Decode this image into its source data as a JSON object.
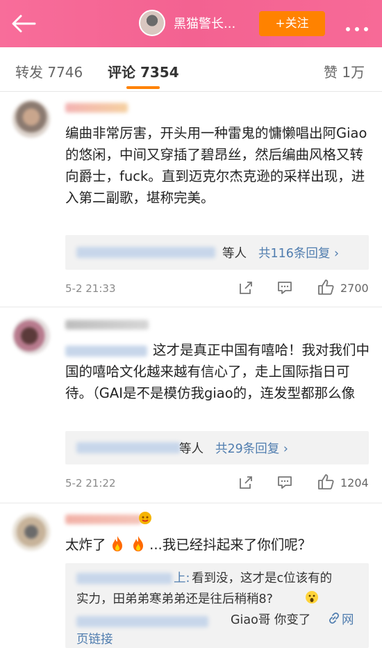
{
  "header": {
    "back_icon": "back-arrow-icon",
    "user_name": "黑猫警长...",
    "follow_label": "+关注",
    "more_icon": "more-dots-icon"
  },
  "tabs": {
    "repost": "转发 7746",
    "comments": "评论 7354",
    "likes": "赞 1万"
  },
  "comments": [
    {
      "text": "编曲非常厉害，开头用一种雷鬼的慵懒唱出阿Giao的悠闲，中间又穿插了碧昂丝，然后编曲风格又转向爵士，fuck。直到迈克尔杰克逊的采样出现，进入第二副歌，堪称完美。",
      "reply_summary_suffix": "等人",
      "reply_count": "共116条回复 ›",
      "time": "5-2 21:33",
      "likes": "2700"
    },
    {
      "text": "这才是真正中国有嘻哈！我对我们中国的嘻哈文化越来越有信心了，走上国际指日可待。（GAI是不是模仿我giao的，连发型都那么像",
      "reply_summary_suffix": "等人",
      "reply_count": "共29条回复 ›",
      "time": "5-2 21:22",
      "likes": "1204"
    },
    {
      "text_before": "太炸了",
      "text_after": "...我已经抖起来了你们呢？",
      "reply1_prefix": "上:",
      "reply1_text": "看到没，这才是c位该有的",
      "reply1_line2": "实力，田弟弟寒弟弟还是往后稍稍8?",
      "reply2_text": "Giao哥  你变了",
      "reply2_link": "网",
      "reply2_link2": "页链接"
    }
  ],
  "colors": {
    "header_pink": "#f36291",
    "follow_orange": "#ff8200",
    "link_orange": "#eb7350"
  }
}
